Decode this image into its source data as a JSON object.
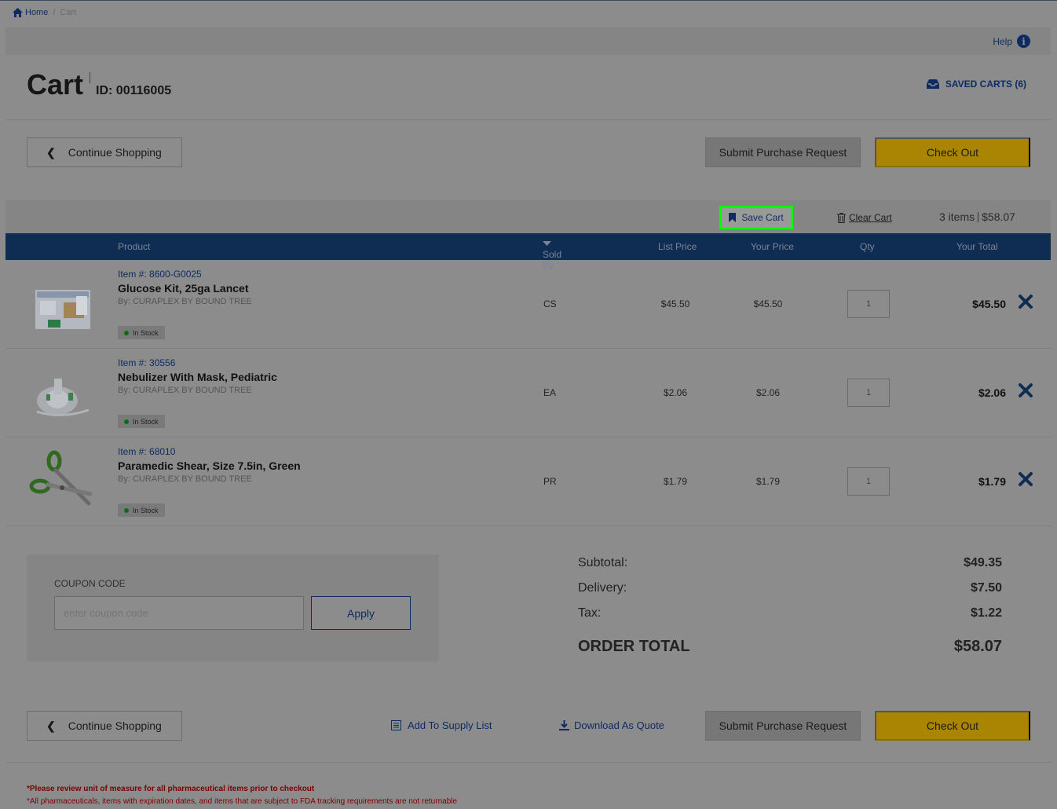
{
  "breadcrumb": {
    "home": "Home",
    "current": "Cart"
  },
  "help": {
    "label": "Help"
  },
  "header": {
    "title": "Cart",
    "cart_id": "ID: 00116005",
    "saved_carts": "SAVED CARTS (6)"
  },
  "actions": {
    "continue_shopping": "Continue Shopping",
    "submit_purchase_request": "Submit Purchase Request",
    "check_out": "Check Out",
    "add_to_supply_list": "Add To Supply List",
    "download_as_quote": "Download As Quote"
  },
  "cart_toolbar": {
    "save_cart": "Save Cart",
    "clear_cart": "Clear Cart",
    "items_count": "3 items",
    "items_total": "$58.07"
  },
  "table": {
    "columns": {
      "product": "Product",
      "sold_by": "Sold By",
      "list_price": "List Price",
      "your_price": "Your Price",
      "qty": "Qty",
      "your_total": "Your Total"
    },
    "rows": [
      {
        "item_no": "Item #: 8600-G0025",
        "name": "Glucose Kit, 25ga Lancet",
        "by": "By: CURAPLEX BY BOUND TREE",
        "stock": "In Stock",
        "sold_by": "CS",
        "list_price": "$45.50",
        "your_price": "$45.50",
        "qty": "1",
        "total": "$45.50",
        "image_icon": "glucose-kit-image"
      },
      {
        "item_no": "Item #: 30556",
        "name": "Nebulizer With Mask, Pediatric",
        "by": "By: CURAPLEX BY BOUND TREE",
        "stock": "In Stock",
        "sold_by": "EA",
        "list_price": "$2.06",
        "your_price": "$2.06",
        "qty": "1",
        "total": "$2.06",
        "image_icon": "nebulizer-mask-image"
      },
      {
        "item_no": "Item #: 68010",
        "name": "Paramedic Shear, Size 7.5in, Green",
        "by": "By: CURAPLEX BY BOUND TREE",
        "stock": "In Stock",
        "sold_by": "PR",
        "list_price": "$1.79",
        "your_price": "$1.79",
        "qty": "1",
        "total": "$1.79",
        "image_icon": "shears-image"
      }
    ]
  },
  "coupon": {
    "label": "COUPON CODE",
    "placeholder": "enter coupon code",
    "apply": "Apply"
  },
  "totals": {
    "subtotal_label": "Subtotal:",
    "subtotal": "$49.35",
    "delivery_label": "Delivery:",
    "delivery": "$7.50",
    "tax_label": "Tax:",
    "tax": "$1.22",
    "order_total_label": "ORDER TOTAL",
    "order_total": "$58.07"
  },
  "notes": {
    "pharma_uom": "*Please review unit of measure for all pharmaceutical items prior to checkout",
    "non_returnable": "*All pharmaceuticals, items with expiration dates, and items that are subject to FDA tracking requirements are not returnable"
  },
  "colors": {
    "navy": "#0f2d52",
    "gold": "#a98503",
    "highlight": "#00ff00",
    "warning_red": "#7d0000"
  }
}
